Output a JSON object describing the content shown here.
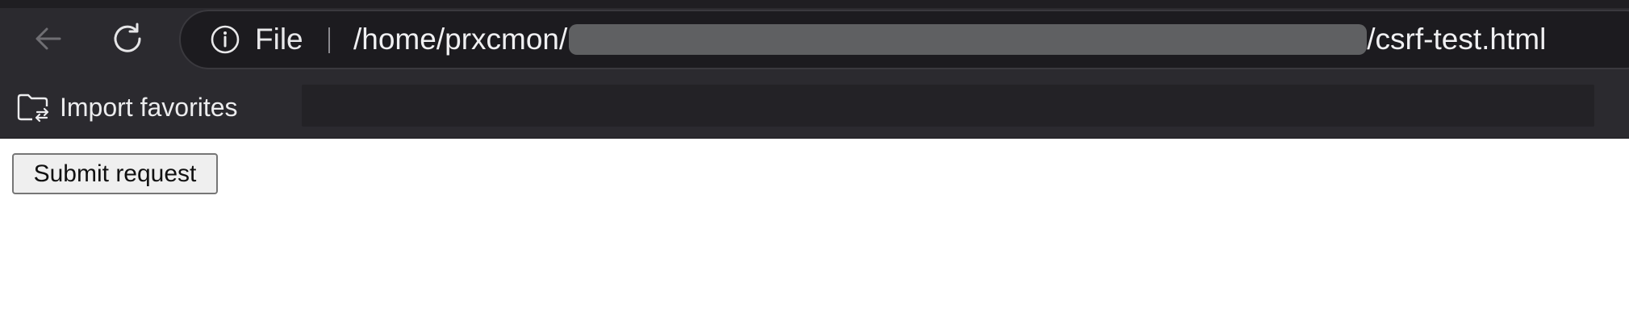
{
  "toolbar": {
    "back_icon": "arrow-left-icon",
    "reload_icon": "reload-icon"
  },
  "address_bar": {
    "info_icon": "info-circle-icon",
    "scheme_label": "File",
    "url_prefix": "/home/prxcmon/",
    "url_suffix": "/csrf-test.html"
  },
  "favorites_bar": {
    "import_icon": "folder-import-icon",
    "import_label": "Import favorites"
  },
  "page": {
    "submit_label": "Submit request"
  },
  "colors": {
    "chrome_bg": "#2b2a2f",
    "address_bg": "#1c1b1f",
    "redaction": "#5f6062",
    "button_bg": "#efefef",
    "button_border": "#767676"
  }
}
